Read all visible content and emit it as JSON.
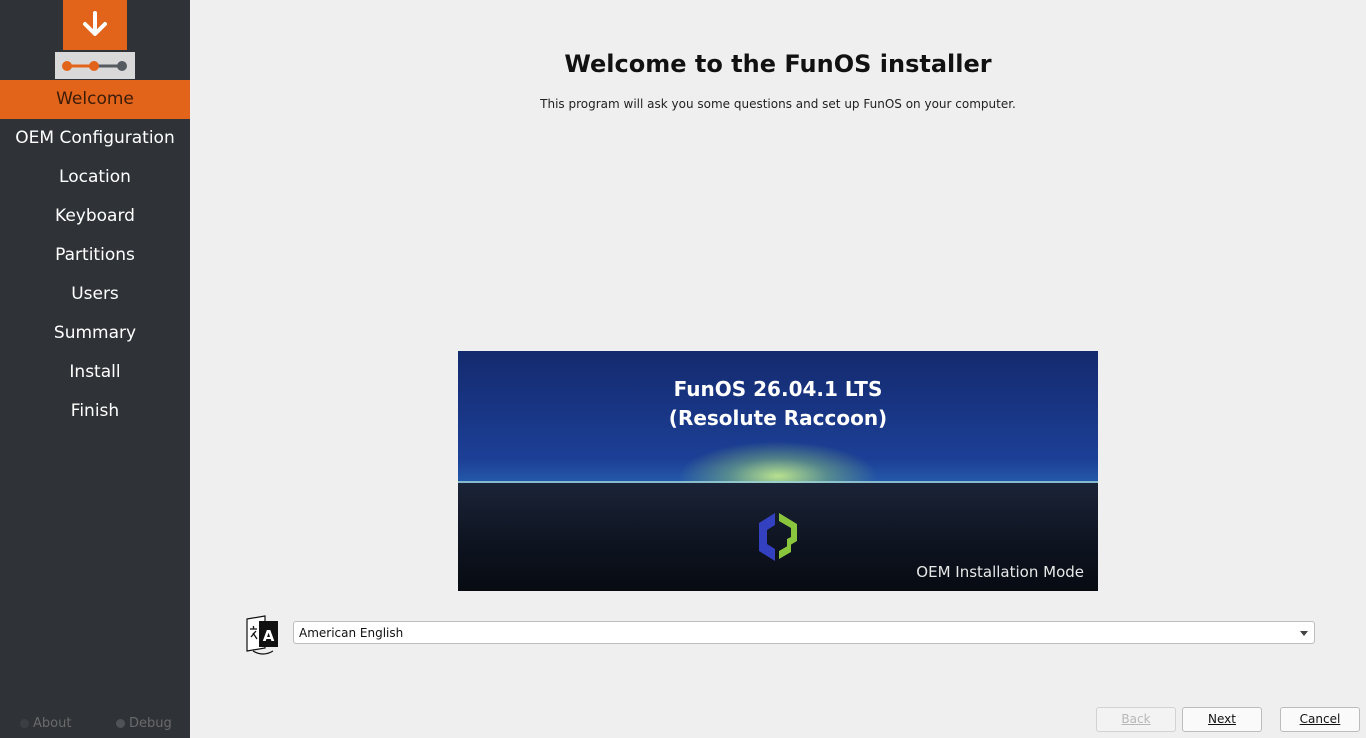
{
  "sidebar": {
    "items": [
      {
        "label": "Welcome",
        "active": true
      },
      {
        "label": "OEM Configuration"
      },
      {
        "label": "Location"
      },
      {
        "label": "Keyboard"
      },
      {
        "label": "Partitions"
      },
      {
        "label": "Users"
      },
      {
        "label": "Summary"
      },
      {
        "label": "Install"
      },
      {
        "label": "Finish"
      }
    ],
    "footer": {
      "about_label": "About",
      "debug_label": "Debug"
    }
  },
  "main": {
    "title": "Welcome to the FunOS installer",
    "subtitle": "This program will ask you some questions and set up FunOS on your computer.",
    "banner": {
      "line1": "FunOS 26.04.1 LTS",
      "line2": "(Resolute Raccoon)",
      "mode": "OEM Installation Mode"
    },
    "language": {
      "selected": "American English"
    }
  },
  "buttons": {
    "back_label": "Back",
    "next_label": "Next",
    "cancel_label": "Cancel"
  },
  "colors": {
    "accent": "#e2631a",
    "sidebar_bg": "#2f3337",
    "page_bg": "#efefef"
  }
}
